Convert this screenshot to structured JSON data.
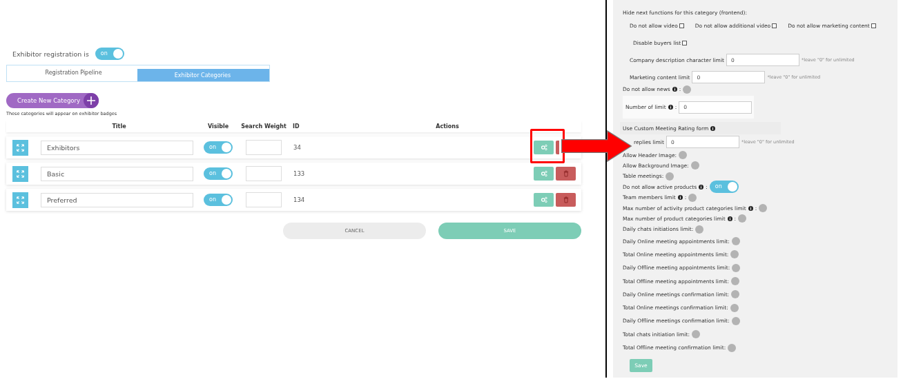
{
  "registration": {
    "label": "Exhibitor registration is",
    "toggle": {
      "on": true,
      "text": "on"
    }
  },
  "tabs": [
    {
      "label": "Registration Pipeline",
      "selected": false
    },
    {
      "label": "Exhibitor Categories",
      "selected": true
    }
  ],
  "create_button": {
    "label": "Create New Category"
  },
  "caption": "These categories will appear on exhibitor badges",
  "table": {
    "columns": [
      "Title",
      "Visible",
      "Search Weight",
      "ID",
      "Actions"
    ],
    "rows": [
      {
        "title": "Exhibitors",
        "visible": {
          "on": true,
          "text": "on"
        },
        "id": "34"
      },
      {
        "title": "Basic",
        "visible": {
          "on": true,
          "text": "on"
        },
        "id": "133"
      },
      {
        "title": "Preferred",
        "visible": {
          "on": true,
          "text": "on"
        },
        "id": "134"
      }
    ]
  },
  "buttons": {
    "cancel": "CANCEL",
    "save": "SAVE"
  },
  "settings": {
    "rows": [
      {
        "kind": "heading",
        "label": "Hide next functions for this category (frontend):"
      },
      {
        "kind": "checkboxes",
        "items": [
          {
            "label": "Do not allow video",
            "checked": false
          },
          {
            "label": "Do not allow additional video",
            "checked": false
          },
          {
            "label": "Do not allow marketing content",
            "checked": false
          }
        ]
      },
      {
        "kind": "checkboxes",
        "items": [
          {
            "label": "Disable buyers list",
            "checked": false
          }
        ]
      },
      {
        "kind": "field",
        "label": "Company description character limit",
        "value": "0",
        "note": "*leave \"0\" for unlimited"
      },
      {
        "kind": "field",
        "label": "Marketing content limit",
        "value": "0",
        "note": "*leave \"0\" for unlimited"
      },
      {
        "kind": "toggle",
        "label": "Do not allow news",
        "info": true,
        "tail": ":",
        "on": false
      },
      {
        "kind": "boxed-field",
        "label": "Number of limit",
        "info": true,
        "tail": ":",
        "value": "0"
      },
      {
        "kind": "select",
        "label": "Use Custom Meeting Rating form",
        "info": true
      },
      {
        "kind": "field",
        "label": "replies limit",
        "value": "0",
        "note": "*leave \"0\" for unlimited"
      },
      {
        "kind": "toggle",
        "label": "Allow Header Image:",
        "on": false
      },
      {
        "kind": "toggle",
        "label": "Allow Background Image:",
        "on": false
      },
      {
        "kind": "toggle",
        "label": "Table meetings:",
        "on": false
      },
      {
        "kind": "toggle",
        "label": "Do not allow active products",
        "info": true,
        "tail": ":",
        "on": true,
        "text": "on"
      },
      {
        "kind": "toggle",
        "label": "Team members limit",
        "info": true,
        "tail": ":",
        "on": false
      },
      {
        "kind": "toggle",
        "label": "Max number of activity product categories limit",
        "info": true,
        "tail": ":",
        "on": false
      },
      {
        "kind": "toggle",
        "label": "Max number of product categories limit",
        "info": true,
        "tail": ":",
        "on": false
      },
      {
        "kind": "toggle",
        "label": "Daily chats initiations limit:",
        "on": false
      },
      {
        "kind": "toggle",
        "label": "Daily Online meeting appointments limit:",
        "on": false
      },
      {
        "kind": "toggle",
        "label": "Total Online meeting appointments limit:",
        "on": false
      },
      {
        "kind": "toggle",
        "label": "Daily Offline meeting appointments limit:",
        "on": false
      },
      {
        "kind": "toggle",
        "label": "Total Offline meeting appointments limit:",
        "on": false
      },
      {
        "kind": "toggle",
        "label": "Daily Online meetings confirmation limit:",
        "on": false
      },
      {
        "kind": "toggle",
        "label": "Total Online meetings confirmation limit:",
        "on": false
      },
      {
        "kind": "toggle",
        "label": "Daily Offline meetings confirmation limit:",
        "on": false
      },
      {
        "kind": "toggle",
        "label": "Total chats initiation limit:",
        "on": false
      },
      {
        "kind": "toggle",
        "label": "Total Offline meeting confirmation limit:",
        "on": false
      }
    ],
    "save": "Save"
  }
}
